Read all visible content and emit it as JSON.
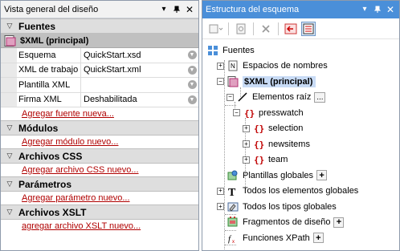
{
  "left_panel": {
    "title": "Vista general del diseño",
    "sections": {
      "fuentes": {
        "label": "Fuentes",
        "source_name": "$XML (principal)",
        "props": [
          {
            "name": "Esquema",
            "value": "QuickStart.xsd"
          },
          {
            "name": "XML de trabajo",
            "value": "QuickStart.xml"
          },
          {
            "name": "Plantilla XML",
            "value": ""
          },
          {
            "name": "Firma XML",
            "value": "Deshabilitada"
          }
        ],
        "add_link": "Agregar fuente nueva..."
      },
      "modulos": {
        "label": "Módulos",
        "add_link": "Agregar módulo nuevo..."
      },
      "css": {
        "label": "Archivos CSS",
        "add_link": "Agregar archivo CSS nuevo..."
      },
      "parametros": {
        "label": "Parámetros",
        "add_link": "Agregar parámetro nuevo..."
      },
      "xslt": {
        "label": "Archivos XSLT",
        "add_link": "agregar archivo XSLT nuevo..."
      }
    }
  },
  "right_panel": {
    "title": "Estructura del esquema",
    "tree": {
      "fuentes": "Fuentes",
      "espacios": "Espacios de nombres",
      "xml_principal": "$XML (principal)",
      "elementos_raiz": "Elementos raíz",
      "presswatch": "presswatch",
      "selection": "selection",
      "newsitems": "newsitems",
      "team": "team",
      "plantillas_globales": "Plantillas globales",
      "todos_elementos": "Todos los elementos globales",
      "todos_tipos": "Todos los tipos globales",
      "fragmentos": "Fragmentos de diseño",
      "funciones": "Funciones XPath"
    },
    "more_label": "...",
    "plus_label": "+"
  },
  "colors": {
    "active_titlebar": "#4a8fd9",
    "section_header": "#dedede",
    "source_row": "#c0c0c0",
    "link": "#b00000",
    "highlight": "#c8dbf5"
  },
  "icons": {
    "pin": "pin-icon",
    "close": "close-icon",
    "dropdown": "dropdown-icon"
  }
}
